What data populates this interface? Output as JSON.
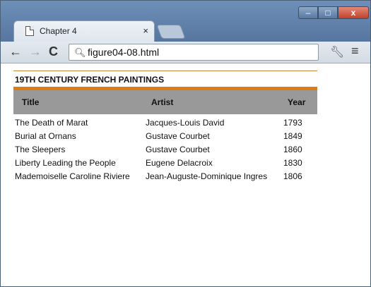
{
  "browser": {
    "tab_title": "Chapter 4",
    "tab_close": "×",
    "url": "figure04-08.html",
    "buttons": {
      "back": "←",
      "forward": "→",
      "reload": "C",
      "menu": "≡",
      "minimize": "–",
      "maximize": "□",
      "close": "x"
    }
  },
  "page": {
    "heading": "19TH CENTURY FRENCH PAINTINGS",
    "table": {
      "headers": {
        "title": "Title",
        "artist": "Artist",
        "year": "Year"
      },
      "rows": [
        {
          "title": "The Death of Marat",
          "artist": "Jacques-Louis David",
          "year": "1793"
        },
        {
          "title": "Burial at Ornans",
          "artist": "Gustave Courbet",
          "year": "1849"
        },
        {
          "title": "The Sleepers",
          "artist": "Gustave Courbet",
          "year": "1860"
        },
        {
          "title": "Liberty Leading the People",
          "artist": "Eugene Delacroix",
          "year": "1830"
        },
        {
          "title": "Mademoiselle Caroline Riviere",
          "artist": "Jean-Auguste-Dominique Ingres",
          "year": "1806"
        }
      ]
    }
  },
  "colors": {
    "accent": "#d97c14",
    "header_bg": "#999999",
    "rule": "#c8903a"
  },
  "icons": [
    "page-icon",
    "search-icon",
    "wrench-icon",
    "menu-icon"
  ]
}
